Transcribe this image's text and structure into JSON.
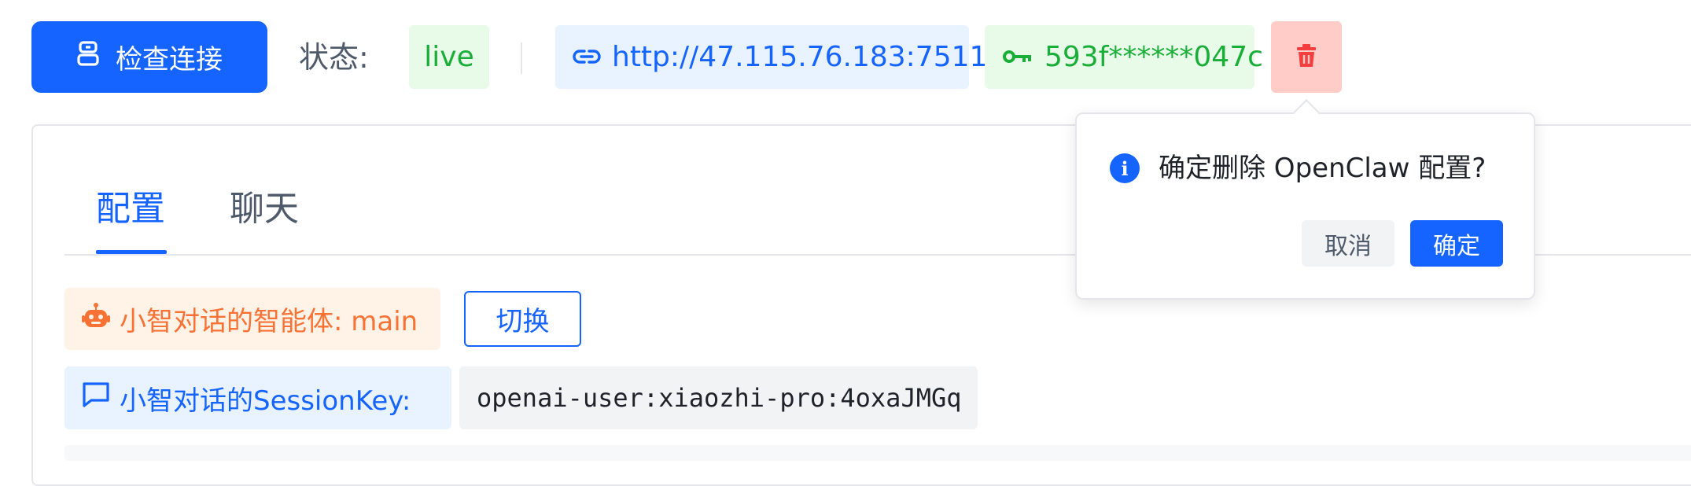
{
  "toolbar": {
    "check_button_label": "检查连接",
    "status_label": "状态:",
    "status_value": "live",
    "url": "http://47.115.76.183:7511",
    "key_masked": "593f******047c"
  },
  "tabs": [
    {
      "label": "配置",
      "active": true
    },
    {
      "label": "聊天",
      "active": false
    }
  ],
  "config": {
    "agent_label": "小智对话的智能体: main",
    "switch_button_label": "切换",
    "session_key_label": "小智对话的SessionKey:",
    "session_key_value": "openai-user:xiaozhi-pro:4oxaJMGq"
  },
  "popconfirm": {
    "message": "确定删除 OpenClaw 配置?",
    "cancel_label": "取消",
    "confirm_label": "确定"
  },
  "colors": {
    "primary": "#1664ff",
    "success": "#1aae39",
    "danger": "#f53f3f",
    "warning": "#f77234"
  },
  "icons": {
    "check_button": "robot-icon",
    "url": "link-icon",
    "key": "key-icon",
    "delete": "trash-icon",
    "agent": "robot-icon",
    "session": "message-icon",
    "popconfirm": "info-icon"
  }
}
